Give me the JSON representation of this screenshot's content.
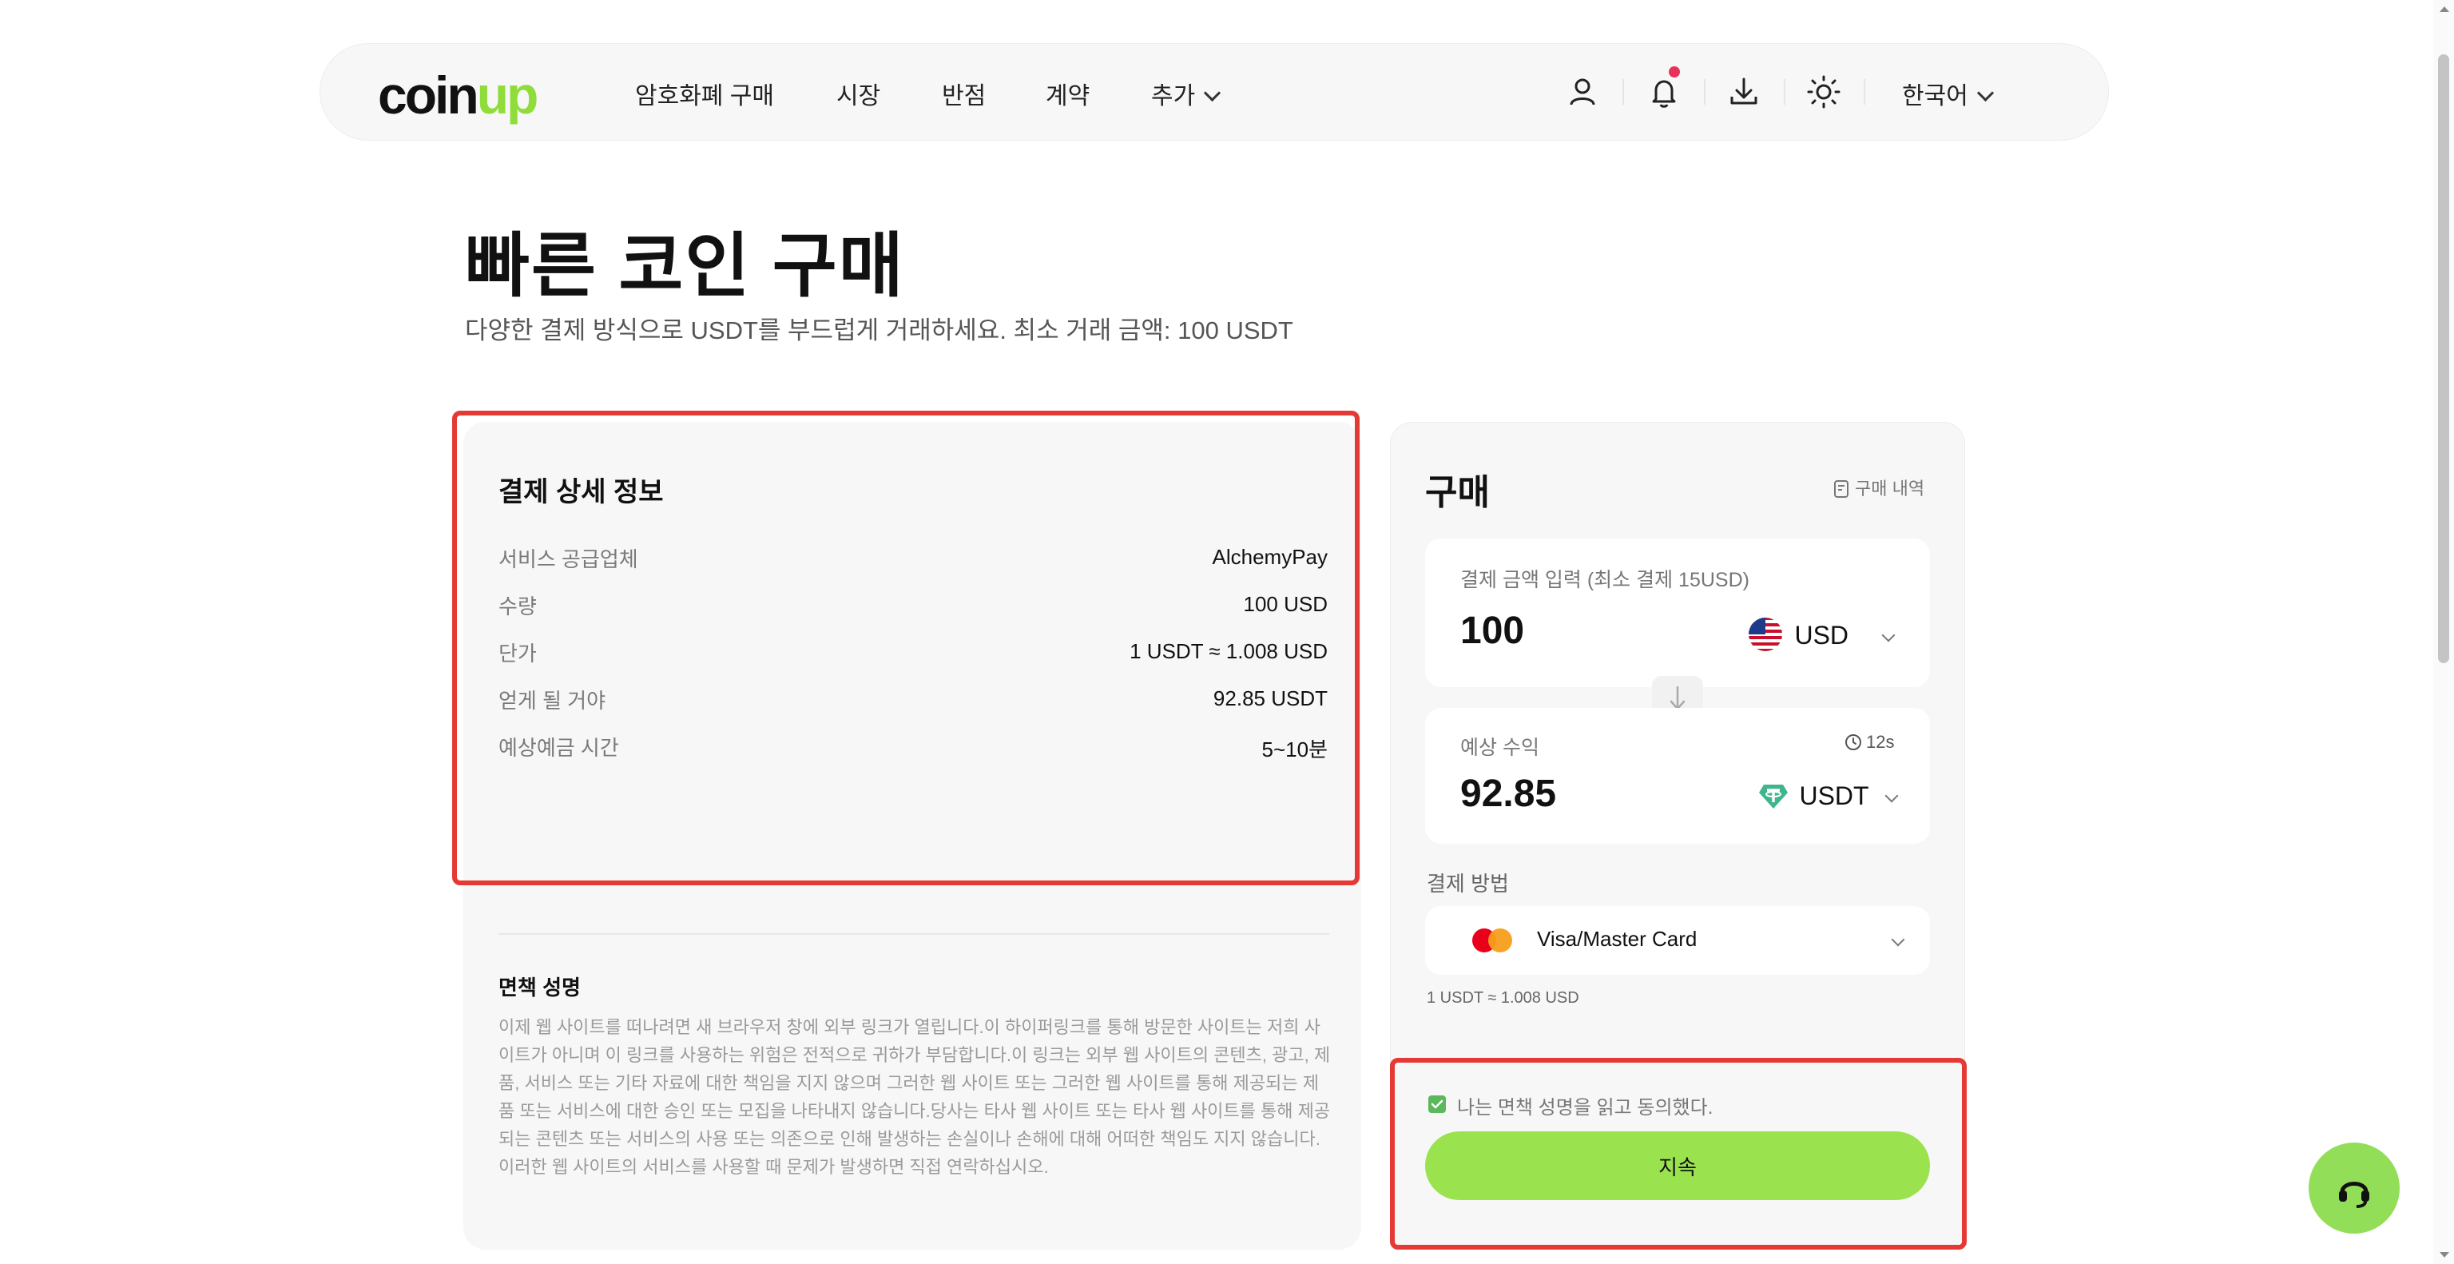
{
  "header": {
    "logo_main": "coin",
    "logo_accent": "up",
    "nav": [
      "암호화폐 구매",
      "시장",
      "반점",
      "계약",
      "추가"
    ],
    "language": "한국어",
    "icons": [
      "user-icon",
      "bell-icon",
      "download-icon",
      "sun-icon"
    ]
  },
  "page": {
    "title": "빠른 코인 구매",
    "subtitle": "다양한 결제 방식으로 USDT를 부드럽게 거래하세요. 최소 거래 금액: 100 USDT"
  },
  "details": {
    "title": "결제 상세 정보",
    "rows": [
      {
        "label": "서비스 공급업체",
        "value": "AlchemyPay"
      },
      {
        "label": "수량",
        "value": "100 USD"
      },
      {
        "label": "단가",
        "value": "1 USDT ≈ 1.008 USD"
      },
      {
        "label": "얻게 될 거야",
        "value": "92.85 USDT"
      },
      {
        "label": "예상예금 시간",
        "value": "5~10분"
      }
    ]
  },
  "disclaimer": {
    "title": "면책 성명",
    "text": "이제 웹 사이트를 떠나려면 새 브라우저 창에 외부 링크가 열립니다.이 하이퍼링크를 통해 방문한 사이트는 저희 사이트가 아니며 이 링크를 사용하는 위험은 전적으로 귀하가 부담합니다.이 링크는 외부 웹 사이트의 콘텐츠, 광고, 제품, 서비스 또는 기타 자료에 대한 책임을 지지 않으며 그러한 웹 사이트 또는 그러한 웹 사이트를 통해 제공되는 제품 또는 서비스에 대한 승인 또는 모집을 나타내지 않습니다.당사는 타사 웹 사이트 또는 타사 웹 사이트를 통해 제공되는 콘텐츠 또는 서비스의 사용 또는 의존으로 인해 발생하는 손실이나 손해에 대해 어떠한 책임도 지지 않습니다.이러한 웹 사이트의 서비스를 사용할 때 문제가 발생하면 직접 연락하십시오."
  },
  "buy": {
    "title": "구매",
    "history": "구매 내역",
    "pay_label": "결제 금액 입력 (최소 결제 15USD)",
    "pay_amount": "100",
    "pay_currency": "USD",
    "receive_label": "예상 수익",
    "receive_timer": "12s",
    "receive_amount": "92.85",
    "receive_currency": "USDT",
    "method_label": "결제 방법",
    "method": "Visa/Master Card",
    "rate": "1 USDT ≈ 1.008 USD",
    "agree": "나는 면책 성명을 읽고 동의했다.",
    "agree_checked": true,
    "continue": "지속"
  },
  "colors": {
    "accent": "#9be24f",
    "highlight": "#e53935",
    "notification": "#e8315b"
  }
}
